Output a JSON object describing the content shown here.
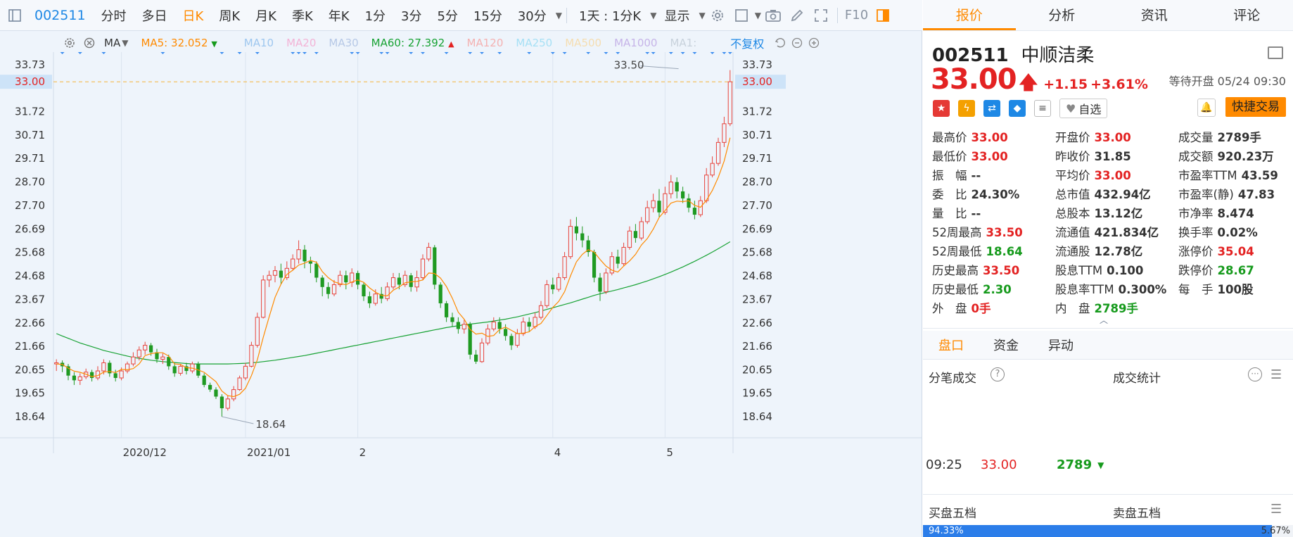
{
  "toolbar": {
    "code": "002511",
    "periods": [
      "分时",
      "多日",
      "日K",
      "周K",
      "月K",
      "季K",
      "年K",
      "1分",
      "3分",
      "5分",
      "15分",
      "30分"
    ],
    "active_period": "日K",
    "multi_label": "1天 : 1分K",
    "display_label": "显示",
    "f10_label": "F10"
  },
  "ma_bar": {
    "ma_label": "MA",
    "ma5_label": "MA5:",
    "ma5_value": "32.052",
    "ma10": "MA10",
    "ma20": "MA20",
    "ma30": "MA30",
    "ma60_label": "MA60:",
    "ma60_value": "27.392",
    "ma120": "MA120",
    "ma250": "MA250",
    "ma500": "MA500",
    "ma1000": "MA1000",
    "ma1": "MA1:",
    "adjust_label": "不复权",
    "colors": {
      "ma5": "#ff8a00",
      "ma10": "#9ec7ef",
      "ma20": "#f3b3d6",
      "ma30": "#b6c8e6",
      "ma60": "#17a233",
      "ma120": "#f4b1b1",
      "ma250": "#a6e0f5",
      "ma500": "#f5ddb0",
      "ma1000": "#c6b4e8",
      "ma1": "#c8d2dc"
    }
  },
  "chart_data": {
    "type": "candlestick",
    "y_ticks": [
      "33.73",
      "32.73",
      "31.72",
      "30.71",
      "29.71",
      "28.70",
      "27.70",
      "26.69",
      "25.68",
      "24.68",
      "23.67",
      "22.66",
      "21.66",
      "20.65",
      "19.65",
      "18.64"
    ],
    "ylim": [
      18.64,
      33.73
    ],
    "x_labels": [
      "2020/12",
      "2021/01",
      "2",
      "4",
      "5"
    ],
    "current_price_label": "33.00",
    "current_price": 33.0,
    "high_annotation": "33.50",
    "low_annotation": "18.64",
    "n_bars": 115,
    "x_label_bar_index": [
      11,
      32,
      51,
      84,
      103
    ],
    "high_bar_index": 106,
    "low_bar_index": 28,
    "candles": [
      [
        20.9,
        20.95,
        20.6,
        21.1
      ],
      [
        20.95,
        20.8,
        20.55,
        21.05
      ],
      [
        20.8,
        20.4,
        20.2,
        20.9
      ],
      [
        20.4,
        20.2,
        20.0,
        20.55
      ],
      [
        20.2,
        20.35,
        20.0,
        20.5
      ],
      [
        20.35,
        20.55,
        20.25,
        20.7
      ],
      [
        20.55,
        20.3,
        20.15,
        20.65
      ],
      [
        20.3,
        20.6,
        20.2,
        20.8
      ],
      [
        20.6,
        20.95,
        20.45,
        21.1
      ],
      [
        20.95,
        20.5,
        20.35,
        21.05
      ],
      [
        20.5,
        20.3,
        20.15,
        20.65
      ],
      [
        20.3,
        20.6,
        20.2,
        20.75
      ],
      [
        20.6,
        20.9,
        20.5,
        21.0
      ],
      [
        20.9,
        21.2,
        20.8,
        21.4
      ],
      [
        21.2,
        21.5,
        21.05,
        21.65
      ],
      [
        21.5,
        21.7,
        21.3,
        21.85
      ],
      [
        21.7,
        21.4,
        21.25,
        21.8
      ],
      [
        21.4,
        21.1,
        20.95,
        21.55
      ],
      [
        21.1,
        21.2,
        20.9,
        21.35
      ],
      [
        21.2,
        20.8,
        20.65,
        21.3
      ],
      [
        20.8,
        20.5,
        20.35,
        20.95
      ],
      [
        20.5,
        20.8,
        20.4,
        20.9
      ],
      [
        20.8,
        20.6,
        20.45,
        20.95
      ],
      [
        20.6,
        20.9,
        20.5,
        21.0
      ],
      [
        20.9,
        20.4,
        20.3,
        21.0
      ],
      [
        20.4,
        20.0,
        19.9,
        20.5
      ],
      [
        20.0,
        19.8,
        19.7,
        20.1
      ],
      [
        19.8,
        19.5,
        19.4,
        19.9
      ],
      [
        19.5,
        19.0,
        18.64,
        19.6
      ],
      [
        19.0,
        19.4,
        18.9,
        19.55
      ],
      [
        19.4,
        19.8,
        19.3,
        19.95
      ],
      [
        19.8,
        20.3,
        19.75,
        20.4
      ],
      [
        20.3,
        20.8,
        20.2,
        20.95
      ],
      [
        20.8,
        21.7,
        20.75,
        21.85
      ],
      [
        21.7,
        22.9,
        21.6,
        23.1
      ],
      [
        22.9,
        24.5,
        22.85,
        24.7
      ],
      [
        24.5,
        24.7,
        24.2,
        24.9
      ],
      [
        24.7,
        24.9,
        24.4,
        25.1
      ],
      [
        24.9,
        24.6,
        24.3,
        25.2
      ],
      [
        24.6,
        25.0,
        24.5,
        25.3
      ],
      [
        25.0,
        25.4,
        24.9,
        25.6
      ],
      [
        25.4,
        25.8,
        25.2,
        26.2
      ],
      [
        25.8,
        25.3,
        25.0,
        26.0
      ],
      [
        25.3,
        25.2,
        24.8,
        25.5
      ],
      [
        25.2,
        24.6,
        24.4,
        25.3
      ],
      [
        24.6,
        24.2,
        23.8,
        24.7
      ],
      [
        24.2,
        23.9,
        23.7,
        24.4
      ],
      [
        23.9,
        24.3,
        23.8,
        24.5
      ],
      [
        24.3,
        24.7,
        24.2,
        24.9
      ],
      [
        24.7,
        24.4,
        24.1,
        24.9
      ],
      [
        24.4,
        24.8,
        24.2,
        25.0
      ],
      [
        24.8,
        24.3,
        24.1,
        24.9
      ],
      [
        24.3,
        23.8,
        23.6,
        24.4
      ],
      [
        23.8,
        23.5,
        23.3,
        24.0
      ],
      [
        23.5,
        23.9,
        23.4,
        24.1
      ],
      [
        23.9,
        23.7,
        23.5,
        24.2
      ],
      [
        23.7,
        24.2,
        23.6,
        24.4
      ],
      [
        24.2,
        24.6,
        24.1,
        24.8
      ],
      [
        24.6,
        24.3,
        24.1,
        24.8
      ],
      [
        24.3,
        24.7,
        24.2,
        24.9
      ],
      [
        24.7,
        24.2,
        24.0,
        24.8
      ],
      [
        24.2,
        24.6,
        24.0,
        24.9
      ],
      [
        24.6,
        25.4,
        24.5,
        25.6
      ],
      [
        25.4,
        25.9,
        25.3,
        26.1
      ],
      [
        25.9,
        24.3,
        24.1,
        26.0
      ],
      [
        24.3,
        23.5,
        23.3,
        24.4
      ],
      [
        23.5,
        22.9,
        22.7,
        23.6
      ],
      [
        22.9,
        22.7,
        22.5,
        23.1
      ],
      [
        22.7,
        22.4,
        22.2,
        22.9
      ],
      [
        22.4,
        22.6,
        22.2,
        22.8
      ],
      [
        22.6,
        21.3,
        21.1,
        22.7
      ],
      [
        21.3,
        21.0,
        20.9,
        21.5
      ],
      [
        21.0,
        21.8,
        20.95,
        22.0
      ],
      [
        21.8,
        22.4,
        21.7,
        22.6
      ],
      [
        22.4,
        22.7,
        22.3,
        22.9
      ],
      [
        22.7,
        22.4,
        22.2,
        22.9
      ],
      [
        22.4,
        22.1,
        21.9,
        22.6
      ],
      [
        22.1,
        21.7,
        21.5,
        22.2
      ],
      [
        21.7,
        22.2,
        21.6,
        22.4
      ],
      [
        22.2,
        22.7,
        22.1,
        22.9
      ],
      [
        22.7,
        22.5,
        22.3,
        22.9
      ],
      [
        22.5,
        22.9,
        22.4,
        23.1
      ],
      [
        22.9,
        23.4,
        22.8,
        23.6
      ],
      [
        23.4,
        24.3,
        23.3,
        24.5
      ],
      [
        24.3,
        24.1,
        23.9,
        24.6
      ],
      [
        24.1,
        24.6,
        24.0,
        24.8
      ],
      [
        24.6,
        25.5,
        24.5,
        25.7
      ],
      [
        25.5,
        26.8,
        25.4,
        27.1
      ],
      [
        26.8,
        26.5,
        26.2,
        27.2
      ],
      [
        26.5,
        26.2,
        25.9,
        26.8
      ],
      [
        26.2,
        25.7,
        25.5,
        26.4
      ],
      [
        25.7,
        24.6,
        24.4,
        25.8
      ],
      [
        24.6,
        24.0,
        23.6,
        24.8
      ],
      [
        24.0,
        24.8,
        23.9,
        25.0
      ],
      [
        24.8,
        25.5,
        24.7,
        25.7
      ],
      [
        25.5,
        25.2,
        25.0,
        25.8
      ],
      [
        25.2,
        25.9,
        25.1,
        26.1
      ],
      [
        25.9,
        26.6,
        25.8,
        26.8
      ],
      [
        26.6,
        26.3,
        26.1,
        26.9
      ],
      [
        26.3,
        27.0,
        26.2,
        27.2
      ],
      [
        27.0,
        27.6,
        26.9,
        27.9
      ],
      [
        27.6,
        27.9,
        27.4,
        28.2
      ],
      [
        27.9,
        27.4,
        27.2,
        28.4
      ],
      [
        27.4,
        28.2,
        27.3,
        28.5
      ],
      [
        28.2,
        28.7,
        28.0,
        29.0
      ],
      [
        28.7,
        28.3,
        28.0,
        28.9
      ],
      [
        28.3,
        28.0,
        27.8,
        28.5
      ],
      [
        28.0,
        27.6,
        27.4,
        28.2
      ],
      [
        27.6,
        27.3,
        27.1,
        27.9
      ],
      [
        27.3,
        27.9,
        27.2,
        28.1
      ],
      [
        27.9,
        29.0,
        27.8,
        29.3
      ],
      [
        29.0,
        29.5,
        28.9,
        29.8
      ],
      [
        29.5,
        30.4,
        29.4,
        30.6
      ],
      [
        30.4,
        31.2,
        30.2,
        31.5
      ],
      [
        31.2,
        33.0,
        31.1,
        33.5
      ]
    ],
    "ma5": [
      20.9,
      20.88,
      20.72,
      20.59,
      20.54,
      20.46,
      20.36,
      20.4,
      20.55,
      20.58,
      20.53,
      20.67,
      20.65,
      20.7,
      20.9,
      21.26,
      21.34,
      21.38,
      21.38,
      21.24,
      20.9,
      20.88,
      20.74,
      20.72,
      20.64,
      20.54,
      20.34,
      20.14,
      19.74,
      19.54,
      19.5,
      19.6,
      19.86,
      20.4,
      21.08,
      22.04,
      22.92,
      23.76,
      24.32,
      24.74,
      24.92,
      25.14,
      25.22,
      25.34,
      25.26,
      24.86,
      24.6,
      24.42,
      24.34,
      24.3,
      24.42,
      24.5,
      24.4,
      24.16,
      23.98,
      23.84,
      23.82,
      24.06,
      24.2,
      24.38,
      24.42,
      24.44,
      24.5,
      24.8,
      24.78,
      24.58,
      24.22,
      23.72,
      23.12,
      22.82,
      22.38,
      22.18,
      22.22,
      22.08,
      22.12,
      22.38,
      22.48,
      22.34,
      22.2,
      22.22,
      22.28,
      22.5,
      22.64,
      22.98,
      23.32,
      23.58,
      24.0,
      24.68,
      25.28,
      25.6,
      25.8,
      25.7,
      25.38,
      25.1,
      24.92,
      24.84,
      25.1,
      25.32,
      25.6,
      26.0,
      26.28,
      26.68,
      27.18,
      27.48,
      27.8,
      27.88,
      27.86,
      27.9,
      27.7,
      27.62,
      27.92,
      28.34,
      28.9,
      29.6,
      30.6
    ],
    "ma60": [
      22.2,
      22.1,
      22.0,
      21.9,
      21.8,
      21.72,
      21.64,
      21.56,
      21.48,
      21.42,
      21.36,
      21.3,
      21.24,
      21.18,
      21.14,
      21.1,
      21.06,
      21.03,
      21.0,
      20.98,
      20.96,
      20.94,
      20.92,
      20.9,
      20.9,
      20.9,
      20.9,
      20.9,
      20.9,
      20.9,
      20.91,
      20.92,
      20.93,
      20.95,
      20.97,
      21.0,
      21.03,
      21.06,
      21.1,
      21.14,
      21.18,
      21.22,
      21.26,
      21.31,
      21.36,
      21.41,
      21.46,
      21.51,
      21.56,
      21.61,
      21.66,
      21.71,
      21.76,
      21.81,
      21.86,
      21.91,
      21.96,
      22.01,
      22.06,
      22.11,
      22.16,
      22.21,
      22.26,
      22.31,
      22.36,
      22.41,
      22.46,
      22.5,
      22.54,
      22.58,
      22.61,
      22.64,
      22.67,
      22.7,
      22.74,
      22.78,
      22.82,
      22.87,
      22.92,
      22.98,
      23.04,
      23.1,
      23.17,
      23.24,
      23.31,
      23.38,
      23.45,
      23.52,
      23.6,
      23.68,
      23.76,
      23.84,
      23.91,
      23.97,
      24.03,
      24.09,
      24.16,
      24.23,
      24.3,
      24.38,
      24.46,
      24.55,
      24.64,
      24.74,
      24.84,
      24.95,
      25.06,
      25.18,
      25.3,
      25.43,
      25.56,
      25.7,
      25.84,
      25.99,
      26.14
    ]
  },
  "quote": {
    "tabs": [
      "报价",
      "分析",
      "资讯",
      "评论"
    ],
    "active_tab": "报价",
    "code": "002511",
    "name": "中顺洁柔",
    "price": "33.00",
    "change": "+1.15",
    "change_pct": "+3.61%",
    "status": "等待开盘 05/24 09:30",
    "watch_label": "自选",
    "fast_trade_label": "快捷交易",
    "rows": [
      [
        {
          "label": "最高价",
          "value": "33.00",
          "color": "red"
        },
        {
          "label": "开盘价",
          "value": "33.00",
          "color": "red"
        },
        {
          "label": "成交量",
          "value": "2789手",
          "color": "dark"
        }
      ],
      [
        {
          "label": "最低价",
          "value": "33.00",
          "color": "red"
        },
        {
          "label": "昨收价",
          "value": "31.85",
          "color": "dark"
        },
        {
          "label": "成交额",
          "value": "920.23万",
          "color": "dark"
        }
      ],
      [
        {
          "label": "振　幅",
          "value": "--",
          "color": "dark"
        },
        {
          "label": "平均价",
          "value": "33.00",
          "color": "red"
        },
        {
          "label": "市盈率TTM",
          "value": "43.59",
          "color": "dark"
        }
      ],
      [
        {
          "label": "委　比",
          "value": "24.30%",
          "color": "dark"
        },
        {
          "label": "总市值",
          "value": "432.94亿",
          "color": "dark"
        },
        {
          "label": "市盈率(静)",
          "value": "47.83",
          "color": "dark"
        }
      ],
      [
        {
          "label": "量　比",
          "value": "--",
          "color": "dark"
        },
        {
          "label": "总股本",
          "value": "13.12亿",
          "color": "dark"
        },
        {
          "label": "市净率",
          "value": "8.474",
          "color": "dark"
        }
      ],
      [
        {
          "label": "52周最高",
          "value": "33.50",
          "color": "red"
        },
        {
          "label": "流通值",
          "value": "421.834亿",
          "color": "dark"
        },
        {
          "label": "换手率",
          "value": "0.02%",
          "color": "dark"
        }
      ],
      [
        {
          "label": "52周最低",
          "value": "18.64",
          "color": "green"
        },
        {
          "label": "流通股",
          "value": "12.78亿",
          "color": "dark"
        },
        {
          "label": "涨停价",
          "value": "35.04",
          "color": "red"
        }
      ],
      [
        {
          "label": "历史最高",
          "value": "33.50",
          "color": "red"
        },
        {
          "label": "股息TTM",
          "value": "0.100",
          "color": "dark"
        },
        {
          "label": "跌停价",
          "value": "28.67",
          "color": "green"
        }
      ],
      [
        {
          "label": "历史最低",
          "value": "2.30",
          "color": "green"
        },
        {
          "label": "股息率TTM",
          "value": "0.300%",
          "color": "dark"
        },
        {
          "label": "每　手",
          "value": "100股",
          "color": "dark"
        }
      ],
      [
        {
          "label": "外　盘",
          "value": "0手",
          "color": "red"
        },
        {
          "label": "内　盘",
          "value": "2789手",
          "color": "green"
        },
        {
          "label": "",
          "value": "",
          "color": "dark"
        }
      ]
    ],
    "subtabs": [
      "盘口",
      "资金",
      "异动"
    ],
    "active_subtab": "盘口",
    "ticks_title": "分笔成交",
    "stats_title": "成交统计",
    "tick": {
      "time": "09:25",
      "price": "33.00",
      "volume": "2789"
    },
    "bid_title": "买盘五档",
    "ask_title": "卖盘五档",
    "bid_pct": "94.33%",
    "ask_pct": "5.67%",
    "colors": {
      "accent": "#ff8a00",
      "up": "#e32222",
      "down": "#169a1c",
      "bar": "#2b7de9"
    }
  }
}
